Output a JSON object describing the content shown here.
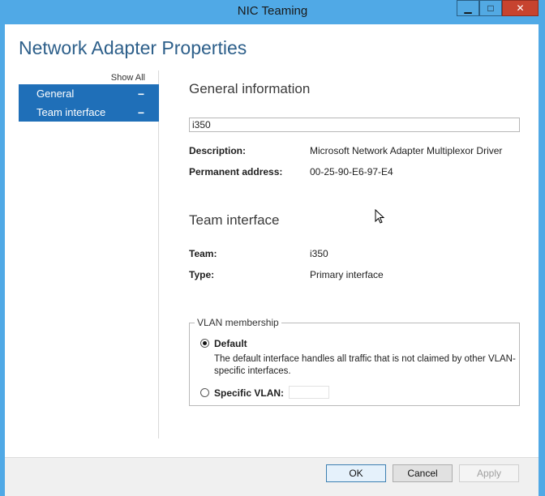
{
  "window": {
    "title": "NIC Teaming",
    "minimize_glyph": "▁",
    "maximize_glyph": "□",
    "close_glyph": "✕"
  },
  "page": {
    "heading": "Network Adapter Properties"
  },
  "nav": {
    "show_all": "Show All",
    "items": [
      {
        "label": "General",
        "toggle": "−"
      },
      {
        "label": "Team interface",
        "toggle": "−"
      }
    ]
  },
  "general": {
    "section_title": "General information",
    "name_value": "i350",
    "description_label": "Description:",
    "description_value": "Microsoft Network Adapter Multiplexor Driver",
    "permanent_address_label": "Permanent address:",
    "permanent_address_value": "00-25-90-E6-97-E4"
  },
  "team_interface": {
    "section_title": "Team interface",
    "team_label": "Team:",
    "team_value": "i350",
    "type_label": "Type:",
    "type_value": "Primary interface"
  },
  "vlan": {
    "legend": "VLAN membership",
    "default_label": "Default",
    "default_desc": "The default interface handles all traffic that is not claimed by other VLAN-specific interfaces.",
    "specific_label": "Specific VLAN:",
    "specific_value": "",
    "selected": "default"
  },
  "footer": {
    "ok": "OK",
    "cancel": "Cancel",
    "apply": "Apply"
  },
  "colors": {
    "title_bar": "#50a9e6",
    "nav_selected": "#1f6fb8",
    "heading": "#2d5f8a",
    "close_button": "#c7432f"
  }
}
